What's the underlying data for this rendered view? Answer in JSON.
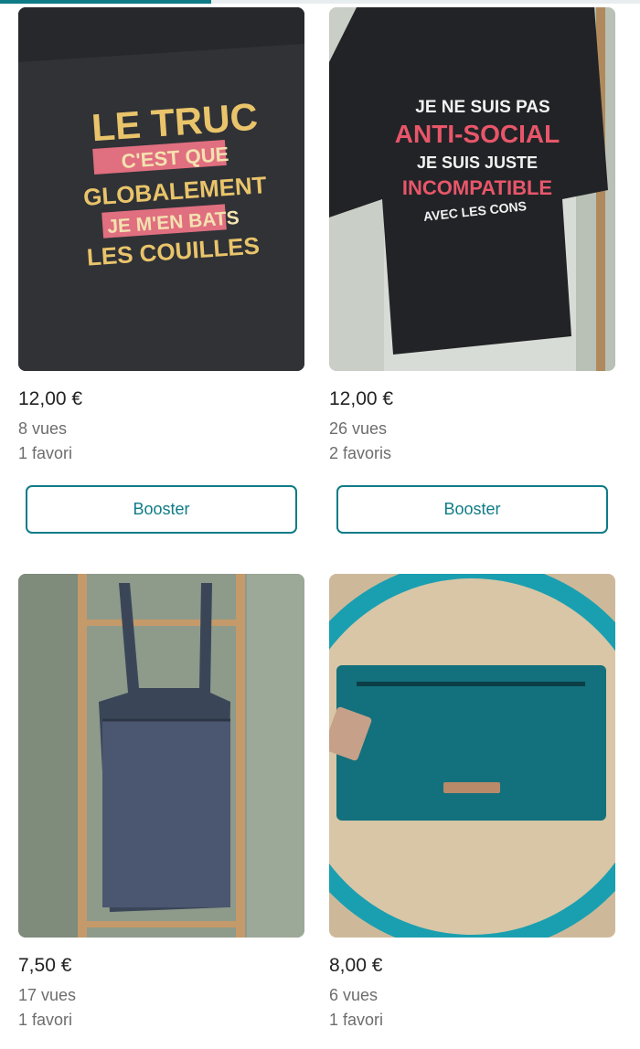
{
  "listings": [
    {
      "price": "12,00 €",
      "views": "8 vues",
      "favorites": "1 favori",
      "button": "Booster",
      "shirt_text": [
        "LE TRUC",
        "C'EST QUE",
        "GLOBALEMENT",
        "JE M'EN BATS",
        "LES COUILLES"
      ]
    },
    {
      "price": "12,00 €",
      "views": "26 vues",
      "favorites": "2 favoris",
      "button": "Booster",
      "shirt_text": [
        "JE NE SUIS PAS",
        "ANTI-SOCIAL",
        "JE SUIS JUSTE",
        "INCOMPATIBLE",
        "AVEC LES CONS"
      ]
    },
    {
      "price": "7,50 €",
      "views": "17 vues",
      "favorites": "1 favori"
    },
    {
      "price": "8,00 €",
      "views": "6 vues",
      "favorites": "1 favori"
    }
  ],
  "scroll_progress": 0.33,
  "colors": {
    "accent": "#0f7b87",
    "muted_text": "#6d6d6d"
  }
}
